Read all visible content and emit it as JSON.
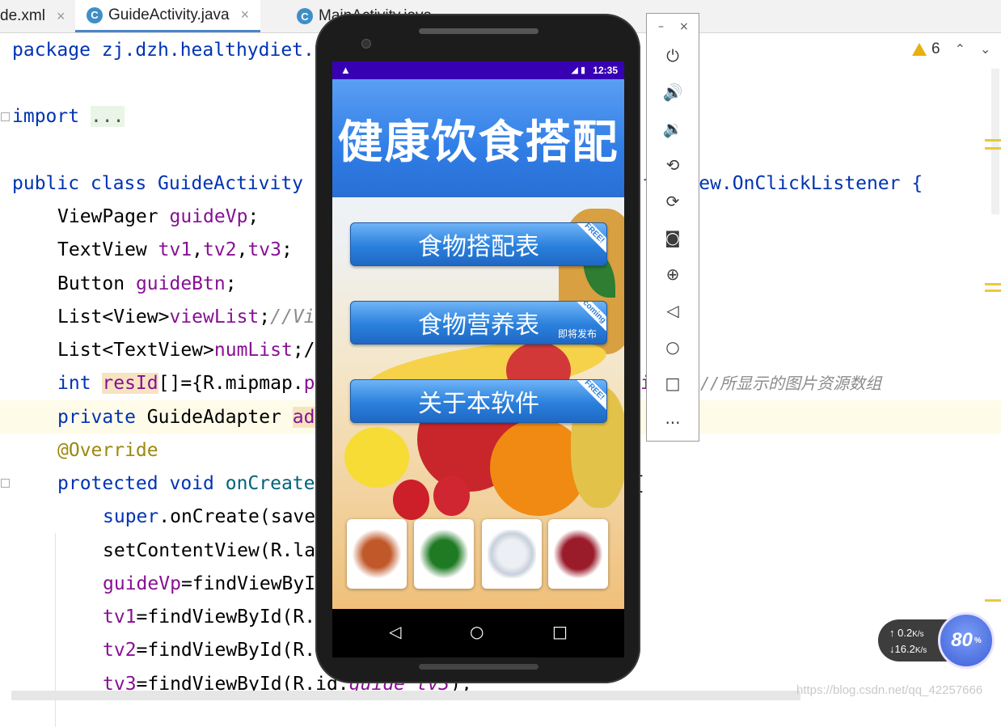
{
  "tabs": [
    {
      "label": "de.xml",
      "active": false
    },
    {
      "label": "GuideActivity.java",
      "active": true,
      "icon": "c-class-icon"
    },
    {
      "label": "MainActivity.java",
      "active": false,
      "icon": "c-class-icon"
    }
  ],
  "inspections": {
    "warning_count": "6"
  },
  "code": {
    "l1": "package zj.dzh.healthydiet.",
    "l2_kw": "import",
    "l2_fold": "...",
    "l3a": "public class GuideActivity",
    "l3b": "ts View.OnClickListener {",
    "l4a": "ViewPager ",
    "l4b": "guideVp",
    "l4c": ";",
    "l5a": "TextView ",
    "l5b": "tv1",
    "l5c": ",",
    "l5d": "tv2",
    "l5e": ",",
    "l5f": "tv3",
    "l5g": ";",
    "l6a": "Button ",
    "l6b": "guideBtn",
    "l6c": ";",
    "l7a": "List<View>",
    "l7b": "viewList",
    "l7c": ";",
    "l7d": "//Vi",
    "l8a": "List<TextView>",
    "l8b": "numList",
    "l8c": ";/",
    "l9a": "int ",
    "l9b": "resId",
    "l9c": "[]={R.mipmap.",
    "l9d": "p",
    "l9e": "i",
    "l9f": "//所显示的图片资源数组",
    "l10a": "private ",
    "l10b": "GuideAdapter ",
    "l10c": "ad",
    "l11": "@Override",
    "l12a": "protected void ",
    "l12b": "onCreate",
    "l12c": "{",
    "l13a": "super",
    "l13b": ".onCreate(save",
    "l14": "setContentView(R.la",
    "l15a": "guideVp",
    "l15b": "=findViewByI",
    "l16a": "tv1",
    "l16b": "=findViewById(R.",
    "l17a": "tv2",
    "l17b": "=findViewById(R.",
    "l18a": "tv3",
    "l18b": "=findViewById(R.id.",
    "l18c": "guide_tv3",
    "l18d": ");"
  },
  "phone": {
    "status_time": "12:35",
    "app_title": "健康饮食搭配",
    "buttons": [
      {
        "label": "食物搭配表",
        "ribbon": "FREE!"
      },
      {
        "label": "食物营养表",
        "ribbon": "coming",
        "note": "即将发布"
      },
      {
        "label": "关于本软件",
        "ribbon": "FREE!"
      }
    ],
    "thumbnails": [
      "crab-image",
      "spinach-image",
      "eggs-image",
      "beef-image"
    ],
    "nav": {
      "back": "◁",
      "home": "○",
      "recents": "□"
    }
  },
  "emulator": {
    "minimize": "–",
    "close": "×",
    "more": "..."
  },
  "network": {
    "up": "0.2",
    "down": "16.2",
    "unit": "K/s",
    "percent": "80",
    "percent_sign": "%"
  },
  "watermark": "https://blog.csdn.net/qq_42257666",
  "colors": {
    "keyword": "#0033b3",
    "field": "#871094",
    "status_bar": "#3700b3",
    "button_blue": "#2a80dc"
  }
}
